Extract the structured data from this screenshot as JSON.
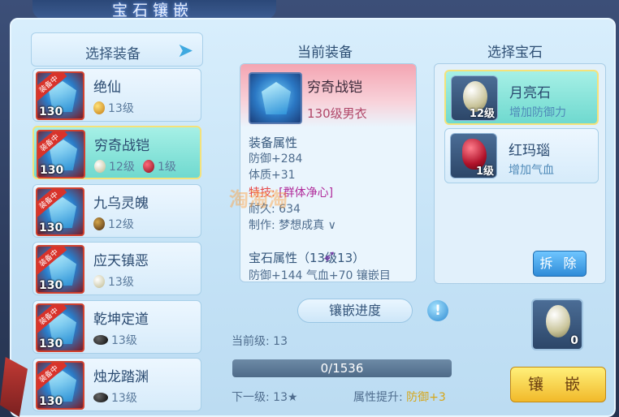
{
  "window": {
    "title": "宝石镶嵌"
  },
  "left": {
    "title": "选择装备",
    "items": [
      {
        "name": "绝仙",
        "level": "130",
        "badge": "装备中",
        "gems": [
          {
            "type": "gold",
            "level": "13级"
          }
        ]
      },
      {
        "name": "穷奇战铠",
        "level": "130",
        "badge": "装备中",
        "gems": [
          {
            "type": "pearl",
            "level": "12级"
          },
          {
            "type": "red",
            "level": "1级"
          }
        ]
      },
      {
        "name": "九乌灵魄",
        "level": "130",
        "badge": "装备中",
        "gems": [
          {
            "type": "brown",
            "level": "12级"
          }
        ]
      },
      {
        "name": "应天镇恶",
        "level": "130",
        "badge": "装备中",
        "gems": [
          {
            "type": "pearl",
            "level": "13级"
          }
        ]
      },
      {
        "name": "乾坤定道",
        "level": "130",
        "badge": "装备中",
        "gems": [
          {
            "type": "black",
            "level": "13级"
          }
        ]
      },
      {
        "name": "烛龙踏渊",
        "level": "130",
        "badge": "装备中",
        "gems": [
          {
            "type": "black",
            "level": "13级"
          }
        ]
      }
    ],
    "selected_index": 1
  },
  "center": {
    "title": "当前装备",
    "item_name": "穷奇战铠",
    "item_sub": "130级男衣",
    "equip_attr_head": "装备属性",
    "defense": "防御+284",
    "constitution": "体质+31",
    "skill_label": "特技:",
    "skill_value": "[群体净心]",
    "durability": "耐久: 634",
    "maker": "制作: 梦想成真 ∨",
    "gem_attr_head": "宝石属性（13级13）",
    "gem_attr_line": "防御+144 气血+70 镶嵌目",
    "progress_label": "镶嵌进度",
    "current_level": "当前级: 13",
    "progress_text": "0/1536",
    "progress_value": 0,
    "next_level": "下一级: 13★",
    "attr_boost_label": "属性提升:",
    "attr_boost_value": "防御+3",
    "watermark": "淘淘淘"
  },
  "right": {
    "title": "选择宝石",
    "gems": [
      {
        "name": "月亮石",
        "desc": "增加防御力",
        "level": "12级",
        "type": "pearl",
        "selected": true
      },
      {
        "name": "红玛瑙",
        "desc": "增加气血",
        "level": "1级",
        "type": "ruby",
        "selected": false
      }
    ],
    "remove_label": "拆 除",
    "slot_count": "0",
    "inlay_label": "镶 嵌"
  },
  "icons": {
    "back": "arrow-icon",
    "info": "info-icon",
    "cursor": "cursor-icon"
  }
}
